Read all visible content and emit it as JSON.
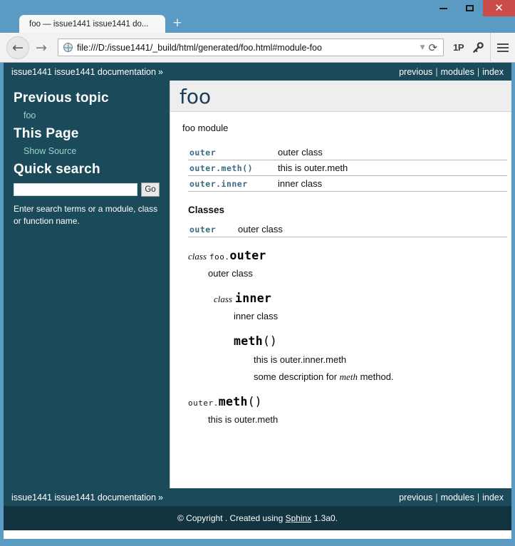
{
  "browser": {
    "tab_title": "foo — issue1441 issue1441 do...",
    "new_tab_label": "+",
    "back_label": "←",
    "forward_label": "→",
    "url": "file:///D:/issue1441/_build/html/generated/foo.html#module-foo",
    "url_dropdown_label": "▼",
    "reload_label": "⟳",
    "onepassword_label": "1P",
    "minimize_label": "—",
    "maximize_label": "□",
    "close_label": "✕",
    "colors": {
      "chrome_blue": "#5b9ac2",
      "close_red": "#cb4b4b",
      "toolbar_gray": "#f2f2f2"
    }
  },
  "page": {
    "title": "foo",
    "intro": "foo module",
    "colors": {
      "related_bar": "#1b4b5a",
      "sidebar_link": "#98d4cd",
      "code_link": "#3b6b84",
      "title": "#1c3b5a",
      "footer": "#123340"
    }
  },
  "related": {
    "breadcrumb": "issue1441 issue1441 documentation",
    "chevron": "»",
    "links": [
      {
        "label": "previous"
      },
      {
        "label": "modules"
      },
      {
        "label": "index"
      }
    ],
    "separator": "|"
  },
  "sidebar": {
    "previous_topic_heading": "Previous topic",
    "previous_topic_link": "foo",
    "this_page_heading": "This Page",
    "show_source_link": "Show Source",
    "quick_search_heading": "Quick search",
    "search_value": "",
    "search_placeholder": "",
    "go_button": "Go",
    "search_note": "Enter search terms or a module, class or function name."
  },
  "module_summary": {
    "rows": [
      {
        "name": "outer",
        "suffix": "",
        "desc": "outer class"
      },
      {
        "name": "outer.meth",
        "suffix": "()",
        "desc": "this is outer.meth"
      },
      {
        "name": "outer.inner",
        "suffix": "",
        "desc": "inner class"
      }
    ]
  },
  "classes_section": {
    "rubric": "Classes",
    "rows": [
      {
        "name": "outer",
        "suffix": "",
        "desc": "outer class"
      }
    ]
  },
  "api": {
    "outer": {
      "keyword": "class",
      "prename": "foo.",
      "name": "outer",
      "desc": "outer class"
    },
    "inner": {
      "keyword": "class",
      "prename": "",
      "name": "inner",
      "desc": "inner class"
    },
    "inner_meth": {
      "keyword": "",
      "prename": "",
      "name": "meth",
      "parens": "()",
      "desc": "this is outer.inner.meth",
      "desc2_pre": "some description for ",
      "desc2_em": "meth",
      "desc2_post": " method."
    },
    "outer_meth": {
      "keyword": "",
      "prename": "outer.",
      "name": "meth",
      "parens": "()",
      "desc": "this is outer.meth"
    }
  },
  "footer": {
    "copyright_pre": "© Copyright . Created using ",
    "sphinx_link": "Sphinx",
    "copyright_post": " 1.3a0."
  }
}
